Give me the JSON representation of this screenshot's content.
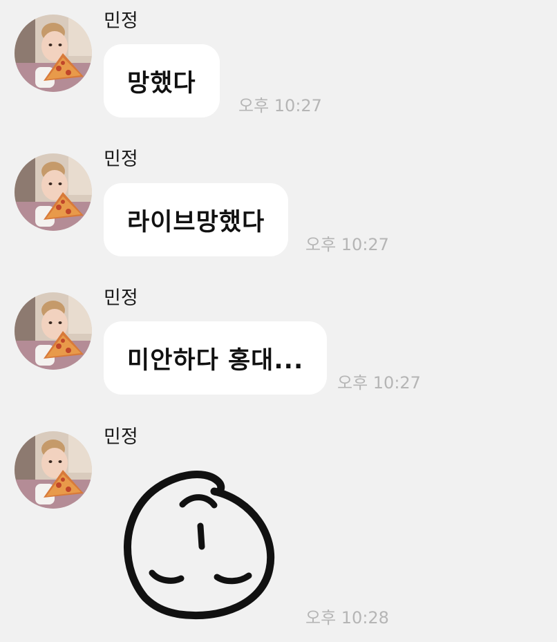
{
  "messages": [
    {
      "sender": "민정",
      "text": "망했다",
      "time": "오후 10:27",
      "type": "text"
    },
    {
      "sender": "민정",
      "text": "라이브망했다",
      "time": "오후 10:27",
      "type": "text"
    },
    {
      "sender": "민정",
      "text": "미안하다 홍대...",
      "time": "오후 10:27",
      "type": "text"
    },
    {
      "sender": "민정",
      "time": "오후 10:28",
      "type": "emoticon",
      "emoticon": "sleepy-face-sticker"
    }
  ],
  "colors": {
    "background": "#f1f1f1",
    "bubble": "#ffffff",
    "time_text": "#b5b5b5",
    "sender_text": "#1a1a1a"
  }
}
